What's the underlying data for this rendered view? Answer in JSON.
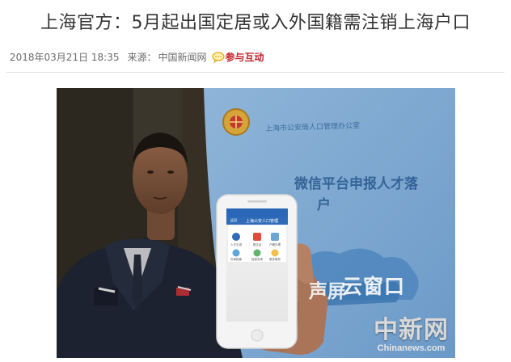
{
  "article": {
    "headline": "上海官方：5月起出国定居或入外国籍需注销上海户口",
    "date": "2018年03月21日 18:35",
    "source_label": "来源：",
    "source_name": "中国新闻网",
    "comment_link": "参与互动"
  },
  "photo": {
    "banner_org": "上海市公安局人口管理办公室",
    "banner_slogan": "微信平台申报人才落",
    "banner_slogan2": "户",
    "banner_cloud_left": "声屏",
    "banner_cloud": "云窗口",
    "phone_title": "上海公安人口管理",
    "phone_back": "返回",
    "app_labels": [
      "人才引进",
      "居住证",
      "户籍办理",
      "办事指南",
      "信息查询",
      "更多服务"
    ],
    "watermark_cn": "中新网",
    "watermark_en": "Chinanews.com"
  },
  "colors": {
    "accent_red": "#c4222c",
    "banner_blue": "#2f6aa3",
    "phone_header": "#2a67b7"
  },
  "icons": {
    "comment": "chat-bubble-icon"
  }
}
